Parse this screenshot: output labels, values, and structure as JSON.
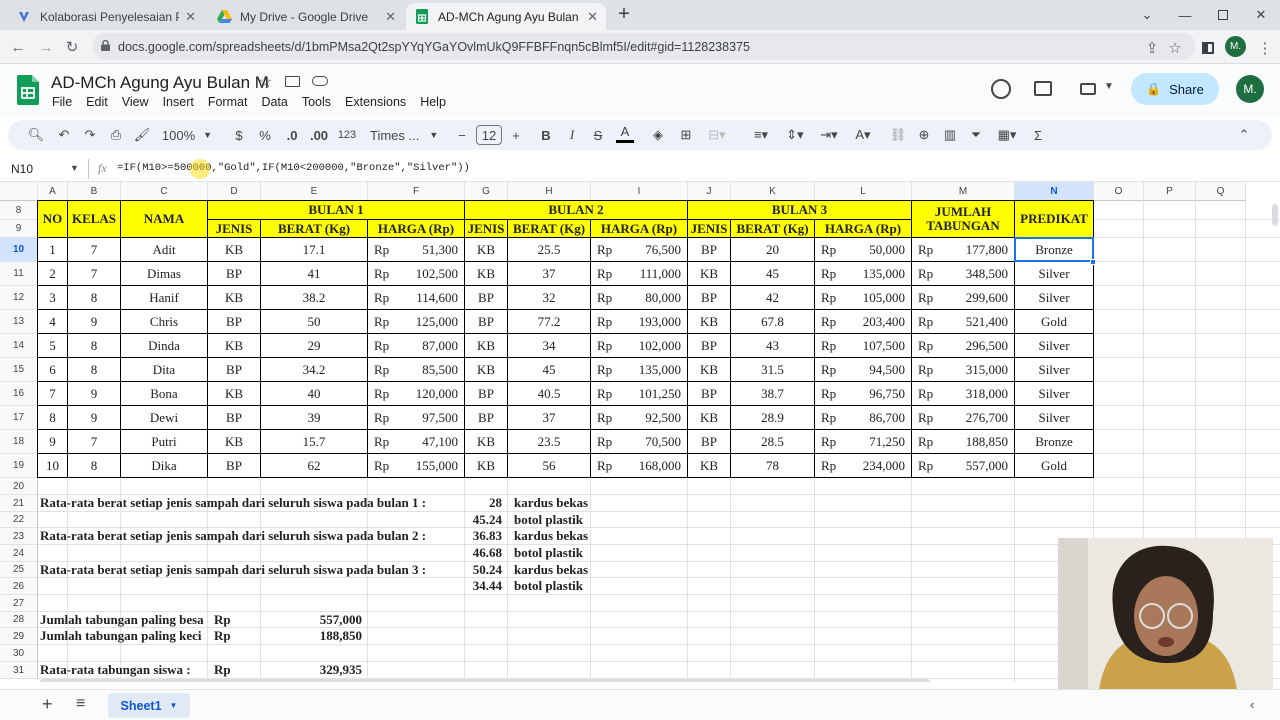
{
  "browser": {
    "tabs": [
      {
        "title": "Kolaborasi Penyelesaian Projek M",
        "icon": "kolaborasi-favicon-icon"
      },
      {
        "title": "My Drive - Google Drive",
        "icon": "drive-favicon-icon"
      },
      {
        "title": "AD-MCh Agung Ayu Bulan M - G",
        "icon": "sheets-favicon-icon",
        "active": true
      }
    ],
    "new_tab": "+",
    "url": "docs.google.com/spreadsheets/d/1bmPMsa2Qt2spYYqYGaYOvlmUkQ9FFBFFnqn5cBlmf5I/edit#gid=1128238375",
    "profile_initial": "M."
  },
  "app": {
    "doc_title": "AD-MCh Agung Ayu Bulan M",
    "menus": [
      "File",
      "Edit",
      "View",
      "Insert",
      "Format",
      "Data",
      "Tools",
      "Extensions",
      "Help"
    ],
    "share_label": "Share",
    "avatar_initial": "M."
  },
  "toolbar": {
    "zoom": "100%",
    "currency": "$",
    "percent": "%",
    "dec_decrease": ".0",
    "dec_increase": ".00",
    "number_format": "123",
    "font": "Times ...",
    "font_size": "12"
  },
  "formula_bar": {
    "cell_ref": "N10",
    "fx": "fx",
    "formula": "=IF(M10>=500000,\"Gold\",IF(M10<200000,\"Bronze\",\"Silver\"))"
  },
  "columns": [
    "A",
    "B",
    "C",
    "D",
    "E",
    "F",
    "G",
    "H",
    "I",
    "J",
    "K",
    "L",
    "M",
    "N",
    "O",
    "P",
    "Q"
  ],
  "rows": [
    "8",
    "9",
    "10",
    "11",
    "12",
    "13",
    "14",
    "15",
    "16",
    "17",
    "18",
    "19",
    "20",
    "21",
    "22",
    "23",
    "24",
    "25",
    "26",
    "27",
    "28",
    "29",
    "30",
    "31"
  ],
  "headers": {
    "no": "NO",
    "kelas": "KELAS",
    "nama": "NAMA",
    "bulan1": "BULAN 1",
    "bulan2": "BULAN 2",
    "bulan3": "BULAN 3",
    "jumlah": "JUMLAH TABUNGAN",
    "predikat": "PREDIKAT",
    "jenis": "JENIS",
    "berat": "BERAT (Kg)",
    "harga": "HARGA (Rp)"
  },
  "currency_label": "Rp",
  "students": [
    {
      "no": "1",
      "kelas": "7",
      "nama": "Adit",
      "j1": "KB",
      "b1": "17.1",
      "h1": "51,300",
      "j2": "KB",
      "b2": "25.5",
      "h2": "76,500",
      "j3": "BP",
      "b3": "20",
      "h3": "50,000",
      "total": "177,800",
      "predikat": "Bronze"
    },
    {
      "no": "2",
      "kelas": "7",
      "nama": "Dimas",
      "j1": "BP",
      "b1": "41",
      "h1": "102,500",
      "j2": "KB",
      "b2": "37",
      "h2": "111,000",
      "j3": "KB",
      "b3": "45",
      "h3": "135,000",
      "total": "348,500",
      "predikat": "Silver"
    },
    {
      "no": "3",
      "kelas": "8",
      "nama": "Hanif",
      "j1": "KB",
      "b1": "38.2",
      "h1": "114,600",
      "j2": "BP",
      "b2": "32",
      "h2": "80,000",
      "j3": "BP",
      "b3": "42",
      "h3": "105,000",
      "total": "299,600",
      "predikat": "Silver"
    },
    {
      "no": "4",
      "kelas": "9",
      "nama": "Chris",
      "j1": "BP",
      "b1": "50",
      "h1": "125,000",
      "j2": "BP",
      "b2": "77.2",
      "h2": "193,000",
      "j3": "KB",
      "b3": "67.8",
      "h3": "203,400",
      "total": "521,400",
      "predikat": "Gold"
    },
    {
      "no": "5",
      "kelas": "8",
      "nama": "Dinda",
      "j1": "KB",
      "b1": "29",
      "h1": "87,000",
      "j2": "KB",
      "b2": "34",
      "h2": "102,000",
      "j3": "BP",
      "b3": "43",
      "h3": "107,500",
      "total": "296,500",
      "predikat": "Silver"
    },
    {
      "no": "6",
      "kelas": "8",
      "nama": "Dita",
      "j1": "BP",
      "b1": "34.2",
      "h1": "85,500",
      "j2": "KB",
      "b2": "45",
      "h2": "135,000",
      "j3": "KB",
      "b3": "31.5",
      "h3": "94,500",
      "total": "315,000",
      "predikat": "Silver"
    },
    {
      "no": "7",
      "kelas": "9",
      "nama": "Bona",
      "j1": "KB",
      "b1": "40",
      "h1": "120,000",
      "j2": "BP",
      "b2": "40.5",
      "h2": "101,250",
      "j3": "BP",
      "b3": "38.7",
      "h3": "96,750",
      "total": "318,000",
      "predikat": "Silver"
    },
    {
      "no": "8",
      "kelas": "9",
      "nama": "Dewi",
      "j1": "BP",
      "b1": "39",
      "h1": "97,500",
      "j2": "BP",
      "b2": "37",
      "h2": "92,500",
      "j3": "KB",
      "b3": "28.9",
      "h3": "86,700",
      "total": "276,700",
      "predikat": "Silver"
    },
    {
      "no": "9",
      "kelas": "7",
      "nama": "Putri",
      "j1": "KB",
      "b1": "15.7",
      "h1": "47,100",
      "j2": "KB",
      "b2": "23.5",
      "h2": "70,500",
      "j3": "BP",
      "b3": "28.5",
      "h3": "71,250",
      "total": "188,850",
      "predikat": "Bronze"
    },
    {
      "no": "10",
      "kelas": "8",
      "nama": "Dika",
      "j1": "BP",
      "b1": "62",
      "h1": "155,000",
      "j2": "KB",
      "b2": "56",
      "h2": "168,000",
      "j3": "KB",
      "b3": "78",
      "h3": "234,000",
      "total": "557,000",
      "predikat": "Gold"
    }
  ],
  "summary": {
    "avg1_label": "Rata-rata berat setiap jenis sampah  dari seluruh siswa pada bulan 1 :",
    "avg2_label": "Rata-rata berat setiap jenis sampah  dari seluruh siswa pada bulan 2 :",
    "avg3_label": "Rata-rata berat setiap jenis sampah  dari seluruh siswa pada bulan 3 :",
    "avg1_kb": "28",
    "avg1_bp": "45.24",
    "avg2_kb": "36.83",
    "avg2_bp": "46.68",
    "avg3_kb": "50.24",
    "avg3_bp": "34.44",
    "kardus": "kardus bekas",
    "botol": "botol plastik",
    "max_label": "Jumlah tabungan paling besa",
    "min_label": "Jumlah tabungan paling keci",
    "avg_label": "Rata-rata tabungan siswa :",
    "max_value": "557,000",
    "min_value": "188,850",
    "avg_value": "329,935"
  },
  "sheets": {
    "active": "Sheet1"
  },
  "colors": {
    "header_fill": "#ffff00",
    "selection": "#1a73e8",
    "share_bg": "#c2e7ff"
  }
}
